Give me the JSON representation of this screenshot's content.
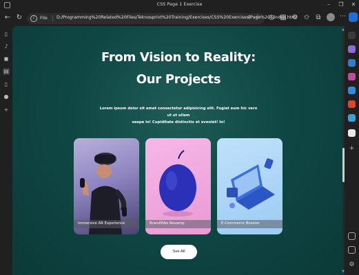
{
  "browser": {
    "window_title": "CSS Page 1 Exercise",
    "address_scheme": "File",
    "url": "D:/Programming%20Related%20Files/Teknosprint%20Training/Exercises/CSS%20Exercises/Page%201/index.html"
  },
  "page": {
    "heading_line1": "From Vision to Reality:",
    "heading_line2": "Our Projects",
    "lede_line1": "Lorem ipsum dolor sit amet consectetur adipisicing elit. Fugiat eum hic vero ut ut ullam",
    "lede_line2": "saepe in! Cupiditate distinctio et eveniet! In!",
    "projects": [
      {
        "label": "Immersive AR Experience"
      },
      {
        "label": "BrandVibe Revamp"
      },
      {
        "label": "E-Commerce Booster"
      }
    ],
    "see_all_label": "See All"
  },
  "colors": {
    "page_bg": "#0f4744",
    "card2_bg": "#f1a7e0",
    "card3_bg": "#a7d4f5",
    "button_bg": "#ffffff",
    "edge_brand": "#1b6fd6"
  }
}
